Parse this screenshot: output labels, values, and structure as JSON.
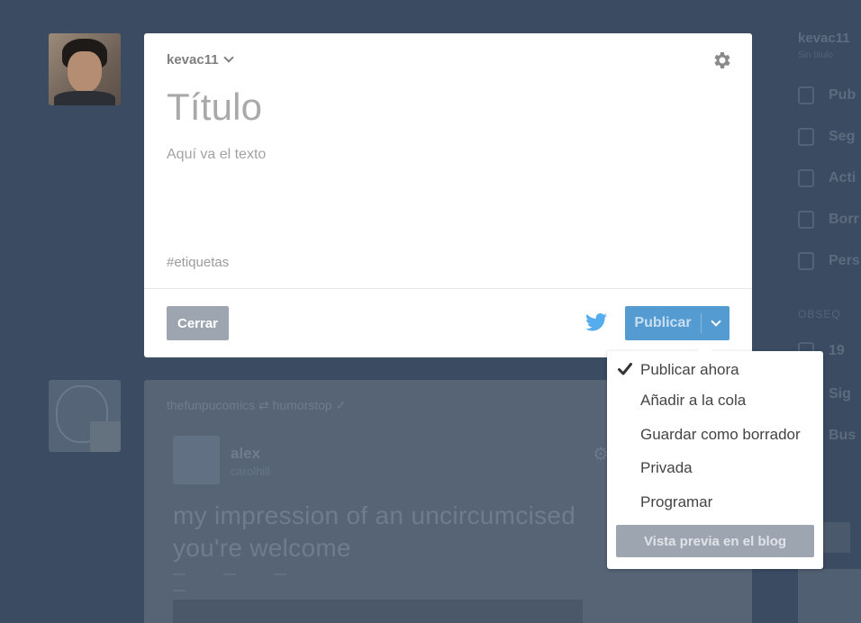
{
  "composer": {
    "blog_name": "kevac11",
    "title_placeholder": "Título",
    "text_placeholder": "Aquí va el texto",
    "tags_placeholder": "#etiquetas",
    "close_label": "Cerrar",
    "publish_label": "Publicar",
    "icons": {
      "settings": "gear-icon",
      "twitter": "twitter-icon",
      "blog_chevron": "chevron-down-icon",
      "publish_caret": "chevron-down-icon"
    }
  },
  "publish_menu": {
    "items": [
      {
        "label": "Publicar ahora",
        "checked": true
      },
      {
        "label": "Añadir a la cola",
        "checked": false
      },
      {
        "label": "Guardar como borrador",
        "checked": false
      },
      {
        "label": "Privada",
        "checked": false
      },
      {
        "label": "Programar",
        "checked": false
      }
    ],
    "preview_label": "Vista previa en el blog"
  },
  "background_post": {
    "post_text": "my impression of an uncircumcised\nyou're welcome",
    "reblogged_user": "alex"
  },
  "colors": {
    "overlay_bg": "#3a4b62",
    "publish_blue": "#539bd1",
    "button_gray": "#9da6b0",
    "twitter_blue": "#55acee"
  }
}
